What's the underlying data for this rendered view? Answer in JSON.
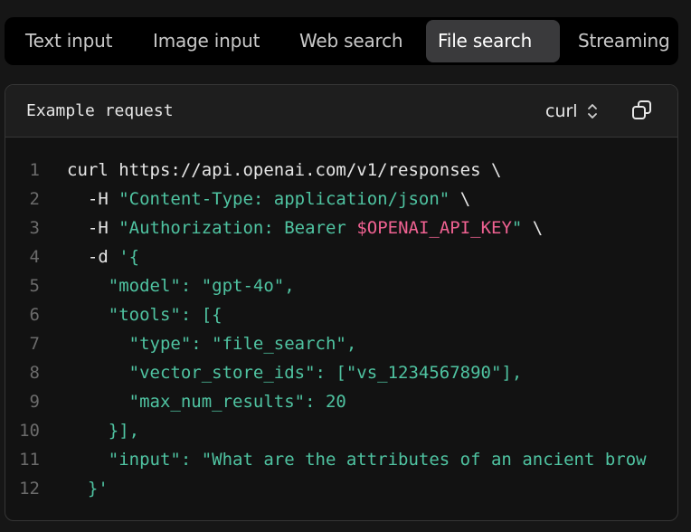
{
  "tabs": [
    {
      "label": "Text input",
      "active": false
    },
    {
      "label": "Image input",
      "active": false
    },
    {
      "label": "Web search",
      "active": false
    },
    {
      "label": "File search",
      "active": true
    },
    {
      "label": "Streaming",
      "active": false
    }
  ],
  "panel": {
    "title": "Example request",
    "language": "curl",
    "icons": {
      "language_toggle": "chevron-up-down-icon",
      "copy": "copy-icon"
    }
  },
  "colors": {
    "string": "#4fc3a1",
    "variable": "#f06292",
    "text": "#e6e6e6",
    "line_number": "#6b6b6b"
  },
  "code": {
    "lines": [
      {
        "n": "1",
        "segments": [
          {
            "t": "curl https://api.openai.com/v1/responses \\",
            "c": ""
          }
        ]
      },
      {
        "n": "2",
        "segments": [
          {
            "t": "  -H ",
            "c": ""
          },
          {
            "t": "\"Content-Type: application/json\"",
            "c": "s"
          },
          {
            "t": " \\",
            "c": ""
          }
        ]
      },
      {
        "n": "3",
        "segments": [
          {
            "t": "  -H ",
            "c": ""
          },
          {
            "t": "\"Authorization: Bearer ",
            "c": "s"
          },
          {
            "t": "$OPENAI_API_KEY",
            "c": "v"
          },
          {
            "t": "\"",
            "c": "s"
          },
          {
            "t": " \\",
            "c": ""
          }
        ]
      },
      {
        "n": "4",
        "segments": [
          {
            "t": "  -d ",
            "c": ""
          },
          {
            "t": "'{",
            "c": "s"
          }
        ]
      },
      {
        "n": "5",
        "segments": [
          {
            "t": "    \"model\": \"gpt-4o\",",
            "c": "s"
          }
        ]
      },
      {
        "n": "6",
        "segments": [
          {
            "t": "    \"tools\": [{",
            "c": "s"
          }
        ]
      },
      {
        "n": "7",
        "segments": [
          {
            "t": "      \"type\": \"file_search\",",
            "c": "s"
          }
        ]
      },
      {
        "n": "8",
        "segments": [
          {
            "t": "      \"vector_store_ids\": [\"vs_1234567890\"],",
            "c": "s"
          }
        ]
      },
      {
        "n": "9",
        "segments": [
          {
            "t": "      \"max_num_results\": 20",
            "c": "s"
          }
        ]
      },
      {
        "n": "10",
        "segments": [
          {
            "t": "    }],",
            "c": "s"
          }
        ]
      },
      {
        "n": "11",
        "segments": [
          {
            "t": "    \"input\": \"What are the attributes of an ancient brow",
            "c": "s"
          }
        ]
      },
      {
        "n": "12",
        "segments": [
          {
            "t": "  }'",
            "c": "s"
          }
        ]
      }
    ]
  }
}
